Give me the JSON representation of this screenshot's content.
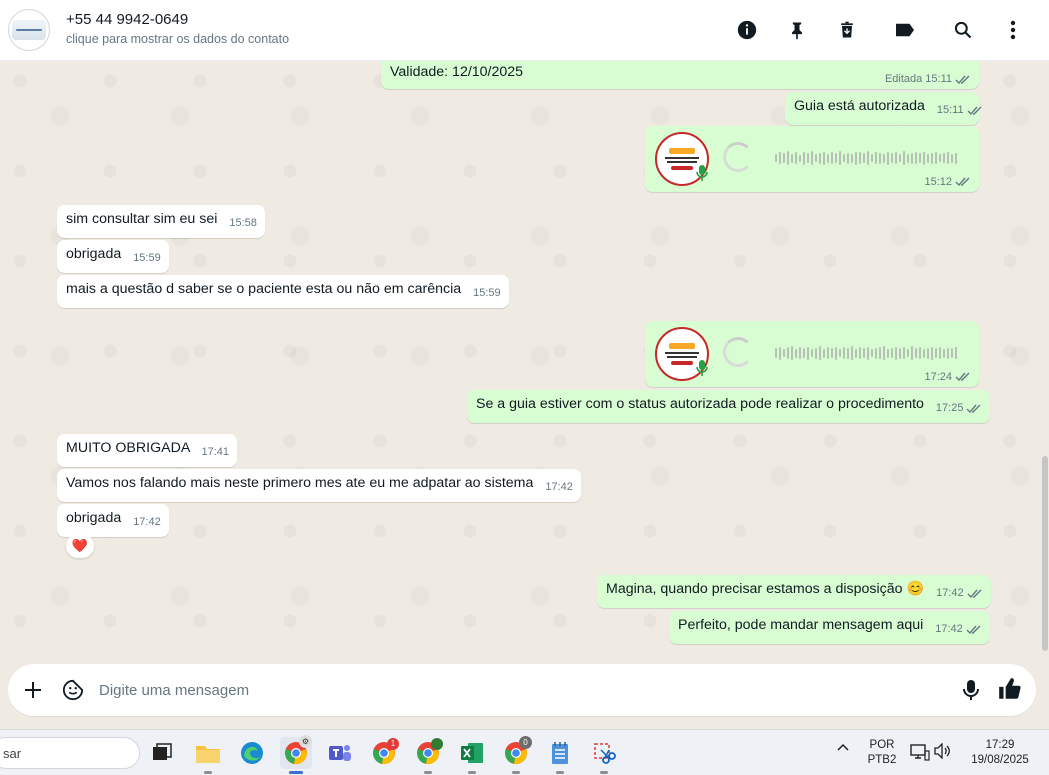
{
  "header": {
    "contact_name": "+55 44 9942-0649",
    "contact_subtitle": "clique para mostrar os dados do contato",
    "icons": [
      "info-icon",
      "pin-icon",
      "delete-icon",
      "label-icon",
      "search-icon",
      "menu-icon"
    ]
  },
  "messages": [
    {
      "dir": "out",
      "text": "Validade: 12/10/2025",
      "edited": "Editada",
      "time": "15:11"
    },
    {
      "dir": "out",
      "text": "Guia está autorizada",
      "time": "15:11"
    },
    {
      "dir": "out",
      "type": "audio",
      "time": "15:12"
    },
    {
      "dir": "in",
      "text": "sim consultar sim eu sei",
      "time": "15:58"
    },
    {
      "dir": "in",
      "text": "obrigada",
      "time": "15:59"
    },
    {
      "dir": "in",
      "text": "mais a questão d saber se o paciente esta ou não em carência",
      "time": "15:59"
    },
    {
      "dir": "out",
      "type": "audio",
      "time": "17:24"
    },
    {
      "dir": "out",
      "text": "Se a guia estiver com o status autorizada pode realizar o procedimento",
      "time": "17:25"
    },
    {
      "dir": "in",
      "text": "MUITO OBRIGADA",
      "time": "17:41"
    },
    {
      "dir": "in",
      "text": "Vamos nos falando mais neste primero mes ate eu me adpatar ao sistema",
      "time": "17:42"
    },
    {
      "dir": "in",
      "text": "obrigada",
      "time": "17:42",
      "reaction": "❤️"
    },
    {
      "dir": "out",
      "text": "Magina, quando precisar estamos a disposição 😊",
      "time": "17:42"
    },
    {
      "dir": "out",
      "text": "Perfeito, pode mandar mensagem aqui",
      "time": "17:42"
    }
  ],
  "composer": {
    "placeholder": "Digite uma mensagem"
  },
  "taskbar": {
    "search_text": "sar",
    "lang_top": "POR",
    "lang_bottom": "PTB2",
    "time": "17:29",
    "date": "19/08/2025",
    "badge_1": "1",
    "badge_2": "0",
    "badge_3": "0"
  },
  "colors": {
    "outgoing_bubble": "#d9fdd3",
    "incoming_bubble": "#ffffff",
    "chat_background": "#efeae2",
    "tick": "#667781"
  }
}
